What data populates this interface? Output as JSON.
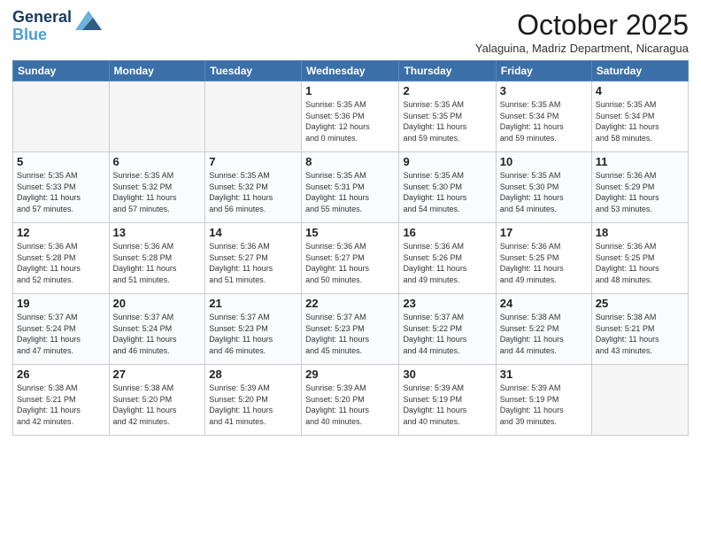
{
  "logo": {
    "line1": "General",
    "line2": "Blue"
  },
  "title": "October 2025",
  "subtitle": "Yalaguina, Madriz Department, Nicaragua",
  "days_header": [
    "Sunday",
    "Monday",
    "Tuesday",
    "Wednesday",
    "Thursday",
    "Friday",
    "Saturday"
  ],
  "weeks": [
    [
      {
        "day": "",
        "info": ""
      },
      {
        "day": "",
        "info": ""
      },
      {
        "day": "",
        "info": ""
      },
      {
        "day": "1",
        "info": "Sunrise: 5:35 AM\nSunset: 5:36 PM\nDaylight: 12 hours\nand 0 minutes."
      },
      {
        "day": "2",
        "info": "Sunrise: 5:35 AM\nSunset: 5:35 PM\nDaylight: 11 hours\nand 59 minutes."
      },
      {
        "day": "3",
        "info": "Sunrise: 5:35 AM\nSunset: 5:34 PM\nDaylight: 11 hours\nand 59 minutes."
      },
      {
        "day": "4",
        "info": "Sunrise: 5:35 AM\nSunset: 5:34 PM\nDaylight: 11 hours\nand 58 minutes."
      }
    ],
    [
      {
        "day": "5",
        "info": "Sunrise: 5:35 AM\nSunset: 5:33 PM\nDaylight: 11 hours\nand 57 minutes."
      },
      {
        "day": "6",
        "info": "Sunrise: 5:35 AM\nSunset: 5:32 PM\nDaylight: 11 hours\nand 57 minutes."
      },
      {
        "day": "7",
        "info": "Sunrise: 5:35 AM\nSunset: 5:32 PM\nDaylight: 11 hours\nand 56 minutes."
      },
      {
        "day": "8",
        "info": "Sunrise: 5:35 AM\nSunset: 5:31 PM\nDaylight: 11 hours\nand 55 minutes."
      },
      {
        "day": "9",
        "info": "Sunrise: 5:35 AM\nSunset: 5:30 PM\nDaylight: 11 hours\nand 54 minutes."
      },
      {
        "day": "10",
        "info": "Sunrise: 5:35 AM\nSunset: 5:30 PM\nDaylight: 11 hours\nand 54 minutes."
      },
      {
        "day": "11",
        "info": "Sunrise: 5:36 AM\nSunset: 5:29 PM\nDaylight: 11 hours\nand 53 minutes."
      }
    ],
    [
      {
        "day": "12",
        "info": "Sunrise: 5:36 AM\nSunset: 5:28 PM\nDaylight: 11 hours\nand 52 minutes."
      },
      {
        "day": "13",
        "info": "Sunrise: 5:36 AM\nSunset: 5:28 PM\nDaylight: 11 hours\nand 51 minutes."
      },
      {
        "day": "14",
        "info": "Sunrise: 5:36 AM\nSunset: 5:27 PM\nDaylight: 11 hours\nand 51 minutes."
      },
      {
        "day": "15",
        "info": "Sunrise: 5:36 AM\nSunset: 5:27 PM\nDaylight: 11 hours\nand 50 minutes."
      },
      {
        "day": "16",
        "info": "Sunrise: 5:36 AM\nSunset: 5:26 PM\nDaylight: 11 hours\nand 49 minutes."
      },
      {
        "day": "17",
        "info": "Sunrise: 5:36 AM\nSunset: 5:25 PM\nDaylight: 11 hours\nand 49 minutes."
      },
      {
        "day": "18",
        "info": "Sunrise: 5:36 AM\nSunset: 5:25 PM\nDaylight: 11 hours\nand 48 minutes."
      }
    ],
    [
      {
        "day": "19",
        "info": "Sunrise: 5:37 AM\nSunset: 5:24 PM\nDaylight: 11 hours\nand 47 minutes."
      },
      {
        "day": "20",
        "info": "Sunrise: 5:37 AM\nSunset: 5:24 PM\nDaylight: 11 hours\nand 46 minutes."
      },
      {
        "day": "21",
        "info": "Sunrise: 5:37 AM\nSunset: 5:23 PM\nDaylight: 11 hours\nand 46 minutes."
      },
      {
        "day": "22",
        "info": "Sunrise: 5:37 AM\nSunset: 5:23 PM\nDaylight: 11 hours\nand 45 minutes."
      },
      {
        "day": "23",
        "info": "Sunrise: 5:37 AM\nSunset: 5:22 PM\nDaylight: 11 hours\nand 44 minutes."
      },
      {
        "day": "24",
        "info": "Sunrise: 5:38 AM\nSunset: 5:22 PM\nDaylight: 11 hours\nand 44 minutes."
      },
      {
        "day": "25",
        "info": "Sunrise: 5:38 AM\nSunset: 5:21 PM\nDaylight: 11 hours\nand 43 minutes."
      }
    ],
    [
      {
        "day": "26",
        "info": "Sunrise: 5:38 AM\nSunset: 5:21 PM\nDaylight: 11 hours\nand 42 minutes."
      },
      {
        "day": "27",
        "info": "Sunrise: 5:38 AM\nSunset: 5:20 PM\nDaylight: 11 hours\nand 42 minutes."
      },
      {
        "day": "28",
        "info": "Sunrise: 5:39 AM\nSunset: 5:20 PM\nDaylight: 11 hours\nand 41 minutes."
      },
      {
        "day": "29",
        "info": "Sunrise: 5:39 AM\nSunset: 5:20 PM\nDaylight: 11 hours\nand 40 minutes."
      },
      {
        "day": "30",
        "info": "Sunrise: 5:39 AM\nSunset: 5:19 PM\nDaylight: 11 hours\nand 40 minutes."
      },
      {
        "day": "31",
        "info": "Sunrise: 5:39 AM\nSunset: 5:19 PM\nDaylight: 11 hours\nand 39 minutes."
      },
      {
        "day": "",
        "info": ""
      }
    ]
  ]
}
